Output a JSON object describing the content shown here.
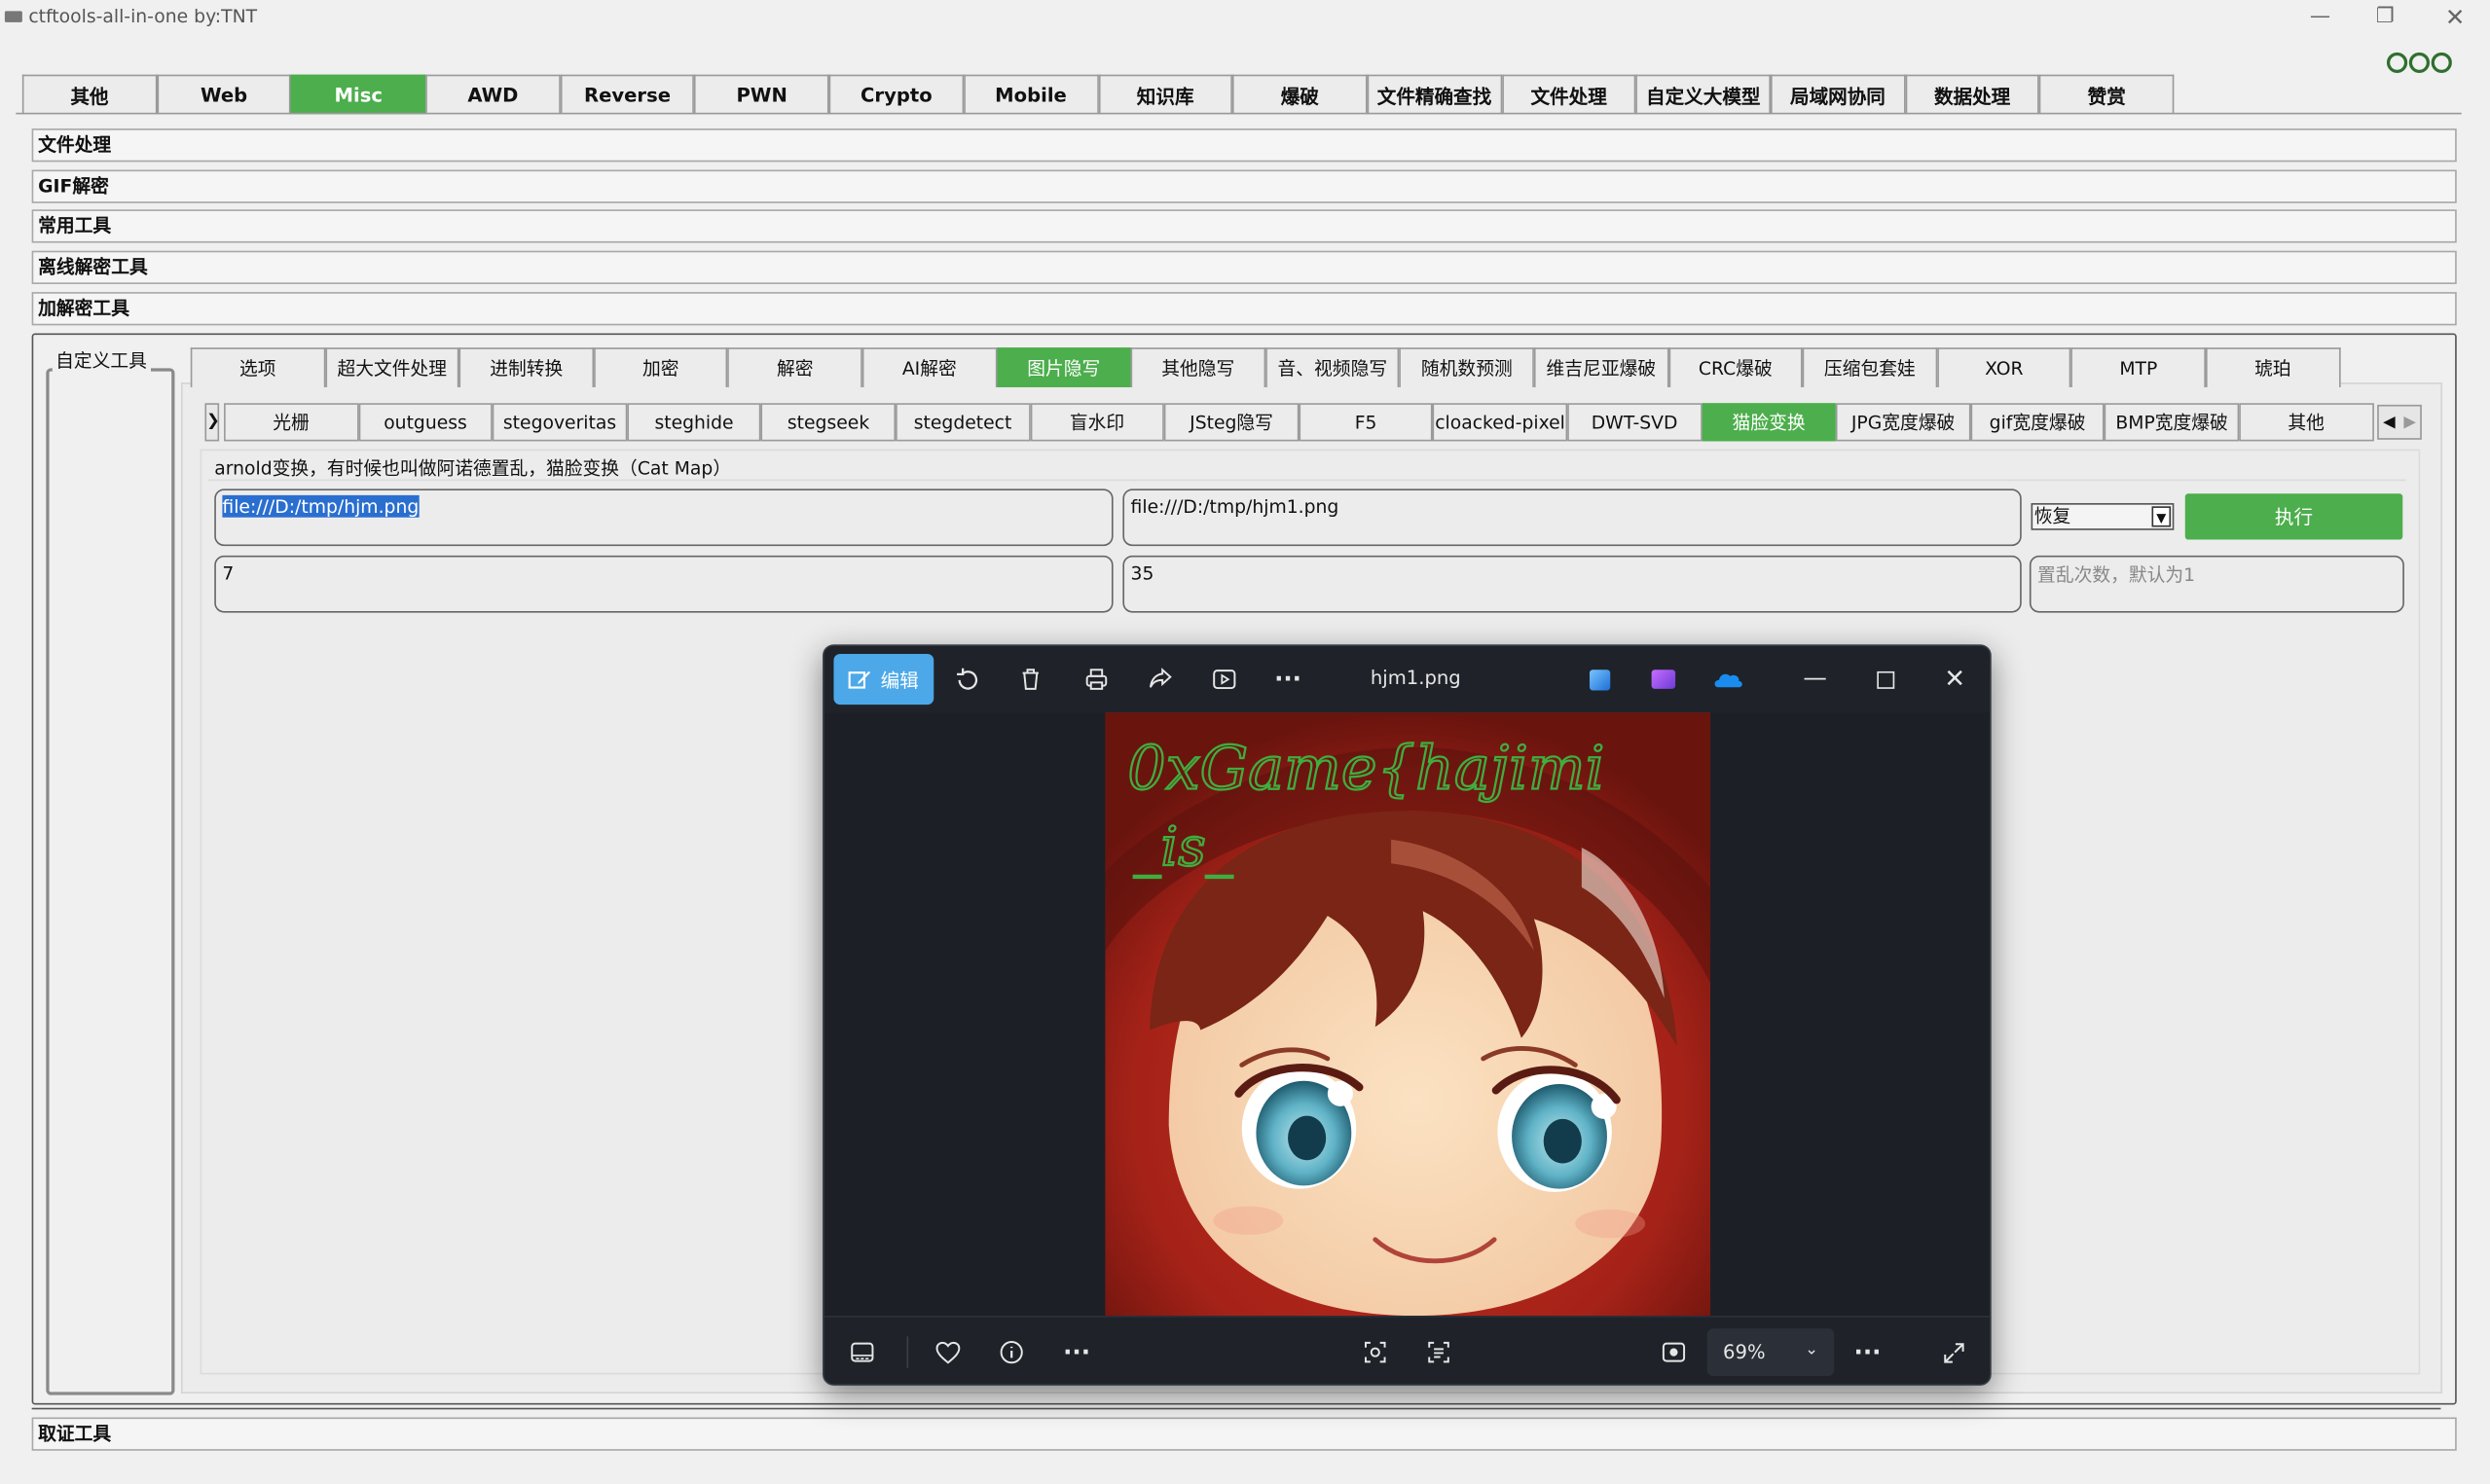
{
  "window": {
    "title": "ctftools-all-in-one   by:TNT",
    "minimize": "—",
    "restore": "❐",
    "close": "✕"
  },
  "main_tabs": [
    "其他",
    "Web",
    "Misc",
    "AWD",
    "Reverse",
    "PWN",
    "Crypto",
    "Mobile",
    "知识库",
    "爆破",
    "文件精确查找",
    "文件处理",
    "自定义大模型",
    "局域网协同",
    "数据处理",
    "赞赏"
  ],
  "main_tabs_active": "Misc",
  "accordion": [
    "文件处理",
    "GIF解密",
    "常用工具",
    "离线解密工具",
    "加解密工具"
  ],
  "accordion_bottom": "取证工具",
  "custom_tools_label": "自定义工具",
  "sub_tabs": [
    "选项",
    "超大文件处理",
    "进制转换",
    "加密",
    "解密",
    "AI解密",
    "图片隐写",
    "其他隐写",
    "音、视频隐写",
    "随机数预测",
    "维吉尼亚爆破",
    "CRC爆破",
    "压缩包套娃",
    "XOR",
    "MTP",
    "琥珀"
  ],
  "sub_tabs_active": "图片隐写",
  "third_tabs": [
    "光栅",
    "outguess",
    "stegoveritas",
    "steghide",
    "stegseek",
    "stegdetect",
    "盲水印",
    "JSteg隐写",
    "F5",
    "cloacked-pixel",
    "DWT-SVD",
    "猫脸变换",
    "JPG宽度爆破",
    "gif宽度爆破",
    "BMP宽度爆破",
    "其他"
  ],
  "third_tabs_active": "猫脸变换",
  "description": "arnold变换，有时候也叫做阿诺德置乱，猫脸变换（Cat Map）",
  "fields": {
    "input_path": "file:///D:/tmp/hjm.png",
    "output_path": "file:///D:/tmp/hjm1.png",
    "param_a": "7",
    "param_b": "35",
    "iterations_placeholder": "置乱次数，默认为1"
  },
  "mode_select": "恢复",
  "execute_label": "执行",
  "viewer": {
    "edit_label": "编辑",
    "filename": "hjm1.png",
    "zoom": "69%",
    "handwriting_line1": "0xGame{hajimi",
    "handwriting_line2": "_is_"
  },
  "colors": {
    "accent_green": "#4cae4c",
    "viewer_bg": "#1c2026",
    "edit_blue": "#4ca8e8",
    "image_red": "#b2281c",
    "ink_green": "#3fae3f"
  }
}
